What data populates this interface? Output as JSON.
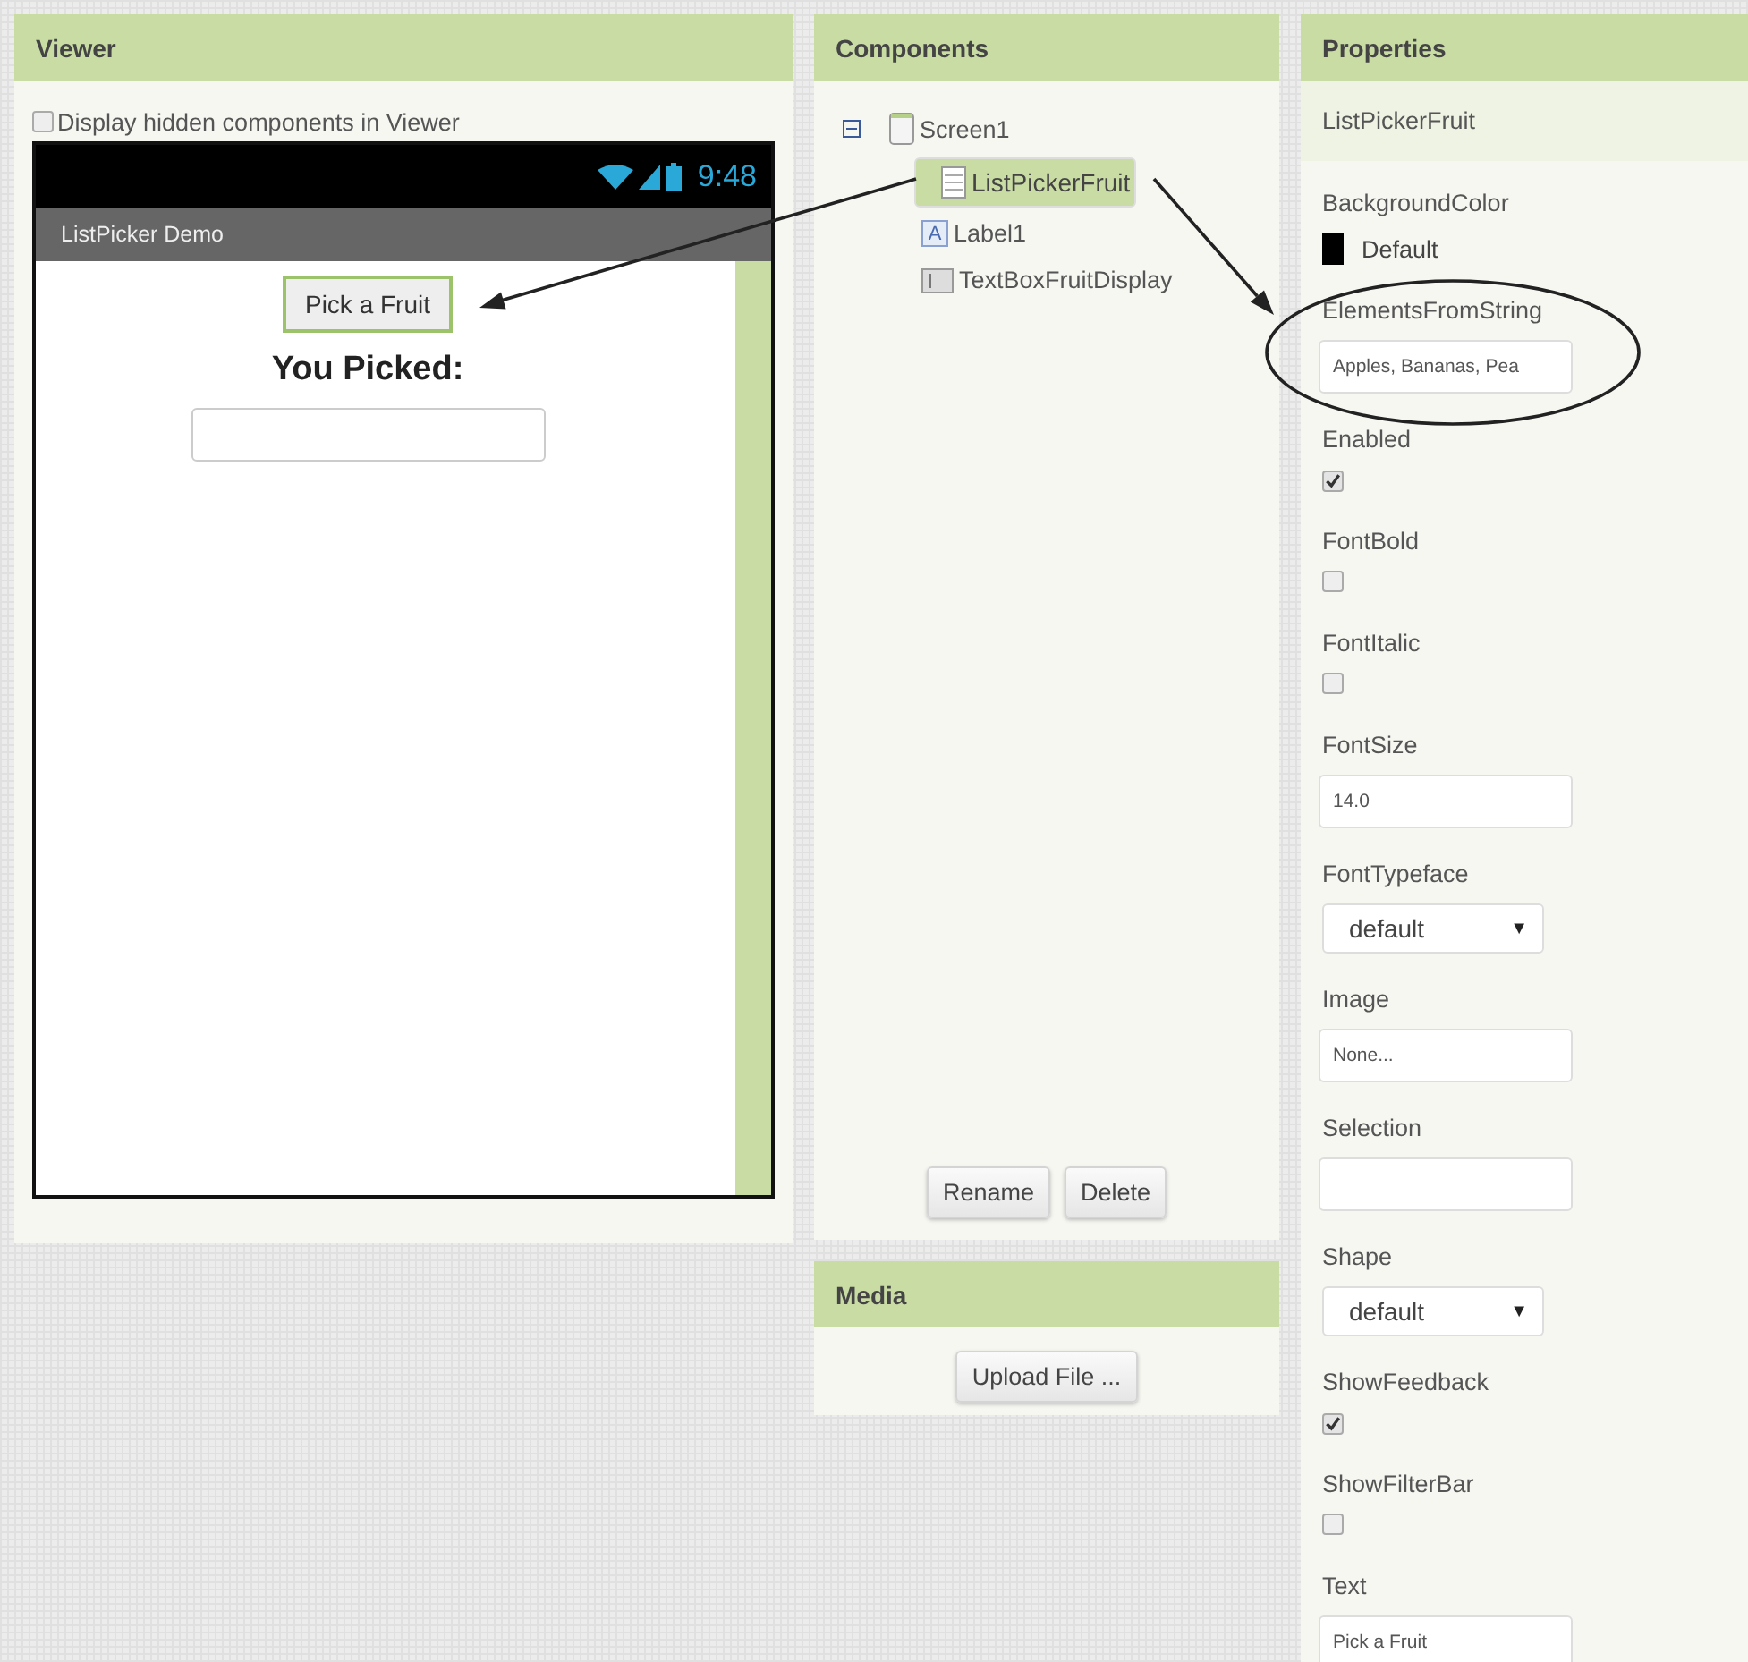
{
  "viewer": {
    "title": "Viewer",
    "hidden_toggle": {
      "label": "Display hidden components in Viewer",
      "checked": false
    },
    "phone": {
      "time": "9:48",
      "app_title": "ListPicker Demo",
      "button": "Pick a Fruit",
      "label": "You Picked:"
    }
  },
  "components": {
    "title": "Components",
    "tree": [
      {
        "name": "Screen1",
        "kind": "screen",
        "expanded": true,
        "selected": false,
        "children": [
          {
            "name": "ListPickerFruit",
            "kind": "listpicker",
            "selected": true
          },
          {
            "name": "Label1",
            "kind": "label",
            "icon_text": "A",
            "selected": false
          },
          {
            "name": "TextBoxFruitDisplay",
            "kind": "textbox",
            "selected": false
          }
        ]
      }
    ],
    "buttons": [
      "Rename",
      "Delete"
    ]
  },
  "media": {
    "title": "Media",
    "button": "Upload File ..."
  },
  "properties": {
    "title": "Properties",
    "component": "ListPickerFruit",
    "items": [
      {
        "label": "BackgroundColor",
        "kind": "color",
        "color": "#000000",
        "value": "Default"
      },
      {
        "label": "ElementsFromString",
        "kind": "text",
        "value": "Apples, Bananas, Pea"
      },
      {
        "label": "Enabled",
        "kind": "checkbox",
        "checked": true
      },
      {
        "label": "FontBold",
        "kind": "checkbox",
        "checked": false
      },
      {
        "label": "FontItalic",
        "kind": "checkbox",
        "checked": false
      },
      {
        "label": "FontSize",
        "kind": "text",
        "value": "14.0"
      },
      {
        "label": "FontTypeface",
        "kind": "select",
        "value": "default",
        "arrow": "▼"
      },
      {
        "label": "Image",
        "kind": "text",
        "value": "None..."
      },
      {
        "label": "Selection",
        "kind": "text"
      },
      {
        "label": "Shape",
        "kind": "select",
        "value": "default",
        "arrow": "▼"
      },
      {
        "label": "ShowFeedback",
        "kind": "checkbox",
        "checked": true
      },
      {
        "label": "ShowFilterBar",
        "kind": "checkbox",
        "checked": false
      },
      {
        "label": "Text",
        "kind": "text",
        "value": "Pick a Fruit"
      }
    ]
  }
}
